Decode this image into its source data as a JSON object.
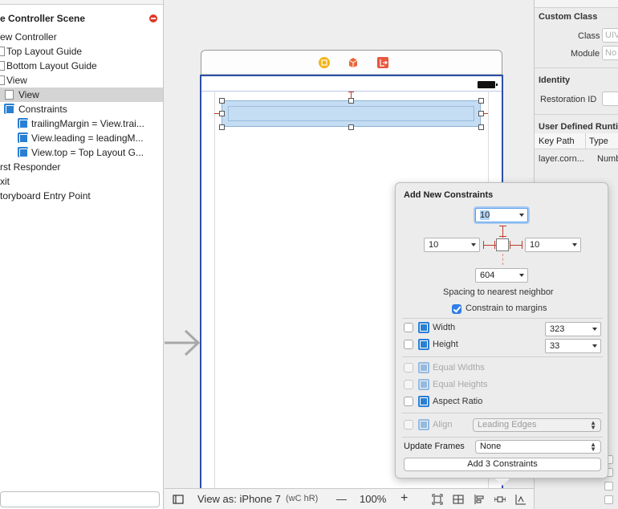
{
  "outline": {
    "scene_title": "e Controller Scene",
    "items": [
      {
        "label": "ew Controller"
      },
      {
        "label": "Top Layout Guide"
      },
      {
        "label": "Bottom Layout Guide"
      },
      {
        "label": "View"
      },
      {
        "label": "View"
      },
      {
        "label": "Constraints"
      },
      {
        "label": "trailingMargin = View.trai..."
      },
      {
        "label": "View.leading = leadingM..."
      },
      {
        "label": "View.top = Top Layout G..."
      },
      {
        "label": "rst Responder"
      },
      {
        "label": "xit"
      },
      {
        "label": "toryboard Entry Point"
      }
    ]
  },
  "bottombar": {
    "view_as": "View as: iPhone 7",
    "size_class": "(wC hR)",
    "zoom_out": "—",
    "zoom": "100%",
    "zoom_in": "+"
  },
  "inspector": {
    "custom_class_header": "Custom Class",
    "class_label": "Class",
    "class_placeholder": "UIV",
    "module_label": "Module",
    "module_placeholder": "No",
    "identity_header": "Identity",
    "restoration_label": "Restoration ID",
    "udra_header": "User Defined Runti",
    "col_keypath": "Key Path",
    "col_type": "Type",
    "row_keypath": "layer.corn...",
    "row_type": "Numb"
  },
  "popover": {
    "title": "Add New Constraints",
    "top_value": "10",
    "left_value": "10",
    "right_value": "10",
    "bottom_value": "604",
    "spacing_label": "Spacing to nearest neighbor",
    "constrain_margins_label": "Constrain to margins",
    "constrain_margins_checked": true,
    "width_label": "Width",
    "width_value": "323",
    "height_label": "Height",
    "height_value": "33",
    "equal_widths_label": "Equal Widths",
    "equal_heights_label": "Equal Heights",
    "aspect_ratio_label": "Aspect Ratio",
    "align_label": "Align",
    "align_value": "Leading Edges",
    "update_frames_label": "Update Frames",
    "update_frames_value": "None",
    "add_button": "Add 3 Constraints"
  },
  "colors": {
    "accent": "#2f7ee8",
    "constraint_red": "#c0392b",
    "selection_fill": "#c5ddf3",
    "root_view_border": "#2b4fa8"
  }
}
